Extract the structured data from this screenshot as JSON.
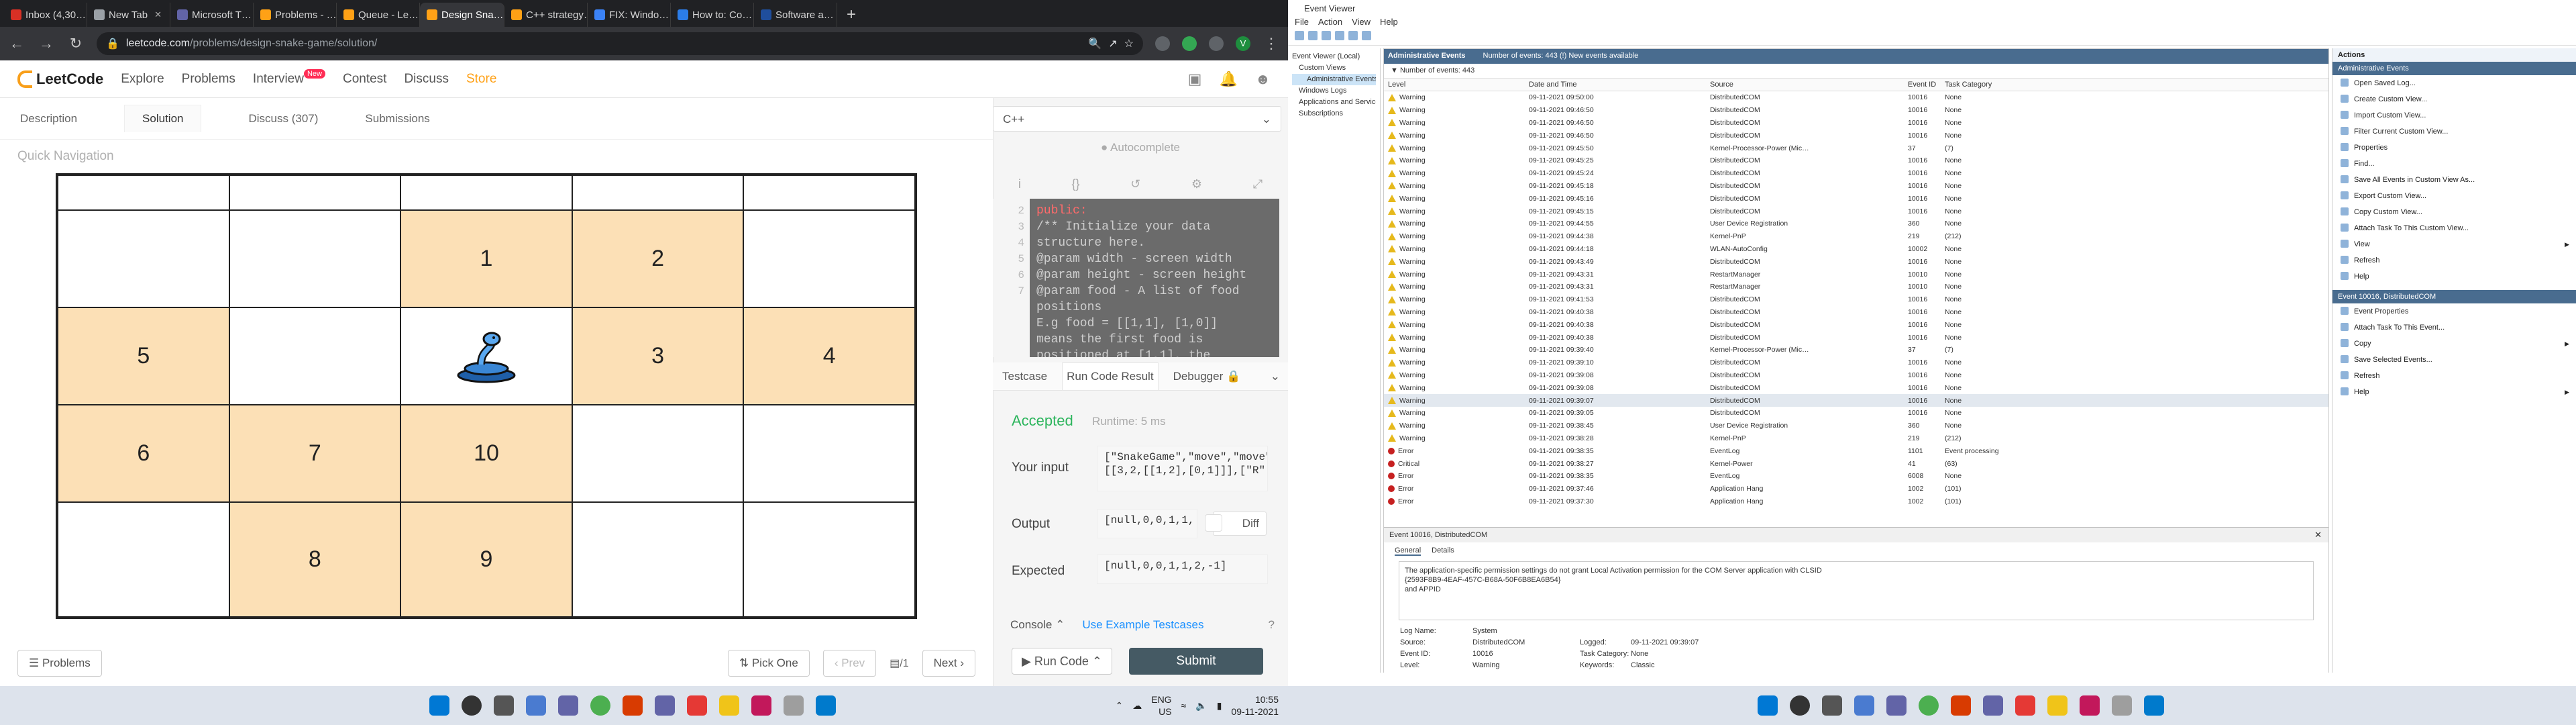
{
  "browser": {
    "tabs": [
      {
        "title": "Inbox (4,30…",
        "color": "#d93025"
      },
      {
        "title": "New Tab",
        "color": "#9aa0a6"
      },
      {
        "title": "Microsoft T…",
        "color": "#6264a7"
      },
      {
        "title": "Problems - …",
        "color": "#ffa116"
      },
      {
        "title": "Queue - Le…",
        "color": "#ffa116"
      },
      {
        "title": "Design Sna…",
        "color": "#ffa116"
      },
      {
        "title": "C++ strategy…",
        "color": "#ffa116"
      },
      {
        "title": "FIX: Windo…",
        "color": "#3b82f6"
      },
      {
        "title": "How to: Co…",
        "color": "#2b7de9"
      },
      {
        "title": "Software a…",
        "color": "#1f4e9c"
      }
    ],
    "url_domain": "leetcode.com",
    "url_path": "/problems/design-snake-game/solution/",
    "profile_initial": "V"
  },
  "leetcode": {
    "logo": "LeetCode",
    "nav": {
      "explore": "Explore",
      "problems": "Problems",
      "interview": "Interview",
      "new_badge": "New",
      "contest": "Contest",
      "discuss": "Discuss",
      "store": "Store"
    },
    "tabs": {
      "description": "Description",
      "solution": "Solution",
      "discuss": "Discuss (307)",
      "submissions": "Submissions"
    },
    "quick_nav": "Quick Navigation",
    "board": [
      [
        "",
        "",
        "",
        "",
        ""
      ],
      [
        "",
        "",
        "1",
        "2",
        ""
      ],
      [
        "5",
        "",
        "snake",
        "3",
        "4"
      ],
      [
        "6",
        "7",
        "10",
        "",
        ""
      ],
      [
        "",
        "8",
        "9",
        "",
        ""
      ]
    ],
    "board_fill": [
      [
        0,
        0,
        0,
        0,
        0
      ],
      [
        0,
        0,
        1,
        1,
        0
      ],
      [
        1,
        0,
        0,
        1,
        1
      ],
      [
        1,
        1,
        1,
        0,
        0
      ],
      [
        0,
        1,
        1,
        0,
        0
      ]
    ],
    "bottom": {
      "problems": "Problems",
      "pick_one": "Pick One",
      "prev": "Prev",
      "page": "1",
      "next": "Next"
    },
    "editor": {
      "language": "C++",
      "autocomplete": "Autocomplete",
      "line_numbers": [
        "2",
        "3",
        "4",
        "5",
        "6",
        "",
        "7"
      ],
      "code": [
        "public:",
        "/** Initialize your data",
        "structure here.",
        "@param width - screen width",
        "@param height - screen height",
        "@param food - A list of food",
        "positions",
        "E.g food = [[1,1], [1,0]]",
        "means the first food is",
        "positioned at [1,1], the"
      ]
    },
    "result": {
      "tab_testcase": "Testcase",
      "tab_run": "Run Code Result",
      "tab_debugger": "Debugger",
      "status": "Accepted",
      "runtime": "Runtime: 5 ms",
      "input_label": "Your input",
      "input_line1": "[\"SnakeGame\",\"move\",\"move\"",
      "input_line2": "[[3,2,[[1,2],[0,1]]],[\"R\"",
      "output_label": "Output",
      "output_value": "[null,0,0,1,1,",
      "diff": "Diff",
      "expected_label": "Expected",
      "expected_value": "[null,0,0,1,1,2,-1]"
    },
    "footer": {
      "console": "Console",
      "examples": "Use Example Testcases",
      "run": "Run Code",
      "submit": "Submit"
    }
  },
  "taskbar_left": {
    "lang1": "ENG",
    "lang2": "US",
    "time": "10:55",
    "date": "09-11-2021"
  },
  "event_viewer": {
    "title": "Event Viewer",
    "menu": [
      "File",
      "Action",
      "View",
      "Help"
    ],
    "tree": [
      "Event Viewer (Local)",
      "Custom Views",
      "Administrative Events",
      "Windows Logs",
      "Applications and Services Lo…",
      "Subscriptions"
    ],
    "header_title": "Administrative Events",
    "header_count": "Number of events: 443 (!) New events available",
    "filter": "Number of events: 443",
    "columns": [
      "Level",
      "Date and Time",
      "Source",
      "Event ID",
      "Task Category"
    ],
    "rows": [
      [
        "Warning",
        "09-11-2021 09:50:00",
        "DistributedCOM",
        "10016",
        "None"
      ],
      [
        "Warning",
        "09-11-2021 09:46:50",
        "DistributedCOM",
        "10016",
        "None"
      ],
      [
        "Warning",
        "09-11-2021 09:46:50",
        "DistributedCOM",
        "10016",
        "None"
      ],
      [
        "Warning",
        "09-11-2021 09:46:50",
        "DistributedCOM",
        "10016",
        "None"
      ],
      [
        "Warning",
        "09-11-2021 09:45:50",
        "Kernel-Processor-Power (Mic…",
        "37",
        "(7)"
      ],
      [
        "Warning",
        "09-11-2021 09:45:25",
        "DistributedCOM",
        "10016",
        "None"
      ],
      [
        "Warning",
        "09-11-2021 09:45:24",
        "DistributedCOM",
        "10016",
        "None"
      ],
      [
        "Warning",
        "09-11-2021 09:45:18",
        "DistributedCOM",
        "10016",
        "None"
      ],
      [
        "Warning",
        "09-11-2021 09:45:16",
        "DistributedCOM",
        "10016",
        "None"
      ],
      [
        "Warning",
        "09-11-2021 09:45:15",
        "DistributedCOM",
        "10016",
        "None"
      ],
      [
        "Warning",
        "09-11-2021 09:44:55",
        "User Device Registration",
        "360",
        "None"
      ],
      [
        "Warning",
        "09-11-2021 09:44:38",
        "Kernel-PnP",
        "219",
        "(212)"
      ],
      [
        "Warning",
        "09-11-2021 09:44:18",
        "WLAN-AutoConfig",
        "10002",
        "None"
      ],
      [
        "Warning",
        "09-11-2021 09:43:49",
        "DistributedCOM",
        "10016",
        "None"
      ],
      [
        "Warning",
        "09-11-2021 09:43:31",
        "RestartManager",
        "10010",
        "None"
      ],
      [
        "Warning",
        "09-11-2021 09:43:31",
        "RestartManager",
        "10010",
        "None"
      ],
      [
        "Warning",
        "09-11-2021 09:41:53",
        "DistributedCOM",
        "10016",
        "None"
      ],
      [
        "Warning",
        "09-11-2021 09:40:38",
        "DistributedCOM",
        "10016",
        "None"
      ],
      [
        "Warning",
        "09-11-2021 09:40:38",
        "DistributedCOM",
        "10016",
        "None"
      ],
      [
        "Warning",
        "09-11-2021 09:40:38",
        "DistributedCOM",
        "10016",
        "None"
      ],
      [
        "Warning",
        "09-11-2021 09:39:40",
        "Kernel-Processor-Power (Mic…",
        "37",
        "(7)"
      ],
      [
        "Warning",
        "09-11-2021 09:39:10",
        "DistributedCOM",
        "10016",
        "None"
      ],
      [
        "Warning",
        "09-11-2021 09:39:08",
        "DistributedCOM",
        "10016",
        "None"
      ],
      [
        "Warning",
        "09-11-2021 09:39:08",
        "DistributedCOM",
        "10016",
        "None"
      ],
      [
        "Warning",
        "09-11-2021 09:39:07",
        "DistributedCOM",
        "10016",
        "None"
      ],
      [
        "Warning",
        "09-11-2021 09:39:05",
        "DistributedCOM",
        "10016",
        "None"
      ],
      [
        "Warning",
        "09-11-2021 09:38:45",
        "User Device Registration",
        "360",
        "None"
      ],
      [
        "Warning",
        "09-11-2021 09:38:28",
        "Kernel-PnP",
        "219",
        "(212)"
      ],
      [
        "Error",
        "09-11-2021 09:38:35",
        "EventLog",
        "1101",
        "Event processing"
      ],
      [
        "Critical",
        "09-11-2021 09:38:27",
        "Kernel-Power",
        "41",
        "(63)"
      ],
      [
        "Error",
        "09-11-2021 09:38:35",
        "EventLog",
        "6008",
        "None"
      ],
      [
        "Error",
        "09-11-2021 09:37:46",
        "Application Hang",
        "1002",
        "(101)"
      ],
      [
        "Error",
        "09-11-2021 09:37:30",
        "Application Hang",
        "1002",
        "(101)"
      ]
    ],
    "selected_row": 24,
    "detail": {
      "title": "Event 10016, DistributedCOM",
      "tabs": [
        "General",
        "Details"
      ],
      "message1": "The application-specific permission settings do not grant Local Activation permission for the COM Server application with CLSID",
      "message2": "{2593F8B9-4EAF-457C-B68A-50F6B8EA6B54}",
      "message3": "and APPID",
      "fields": [
        [
          "Log Name:",
          "System",
          "",
          ""
        ],
        [
          "Source:",
          "DistributedCOM",
          "Logged:",
          "09-11-2021 09:39:07"
        ],
        [
          "Event ID:",
          "10016",
          "Task Category:",
          "None"
        ],
        [
          "Level:",
          "Warning",
          "Keywords:",
          "Classic"
        ]
      ]
    },
    "actions": {
      "header": "Actions",
      "sec1": "Administrative Events",
      "items1": [
        "Open Saved Log...",
        "Create Custom View...",
        "Import Custom View...",
        "Filter Current Custom View...",
        "Properties",
        "Find...",
        "Save All Events in Custom View As...",
        "Export Custom View...",
        "Copy Custom View...",
        "Attach Task To This Custom View...",
        "View",
        "Refresh",
        "Help"
      ],
      "sec2": "Event 10016, DistributedCOM",
      "items2": [
        "Event Properties",
        "Attach Task To This Event...",
        "Copy",
        "Save Selected Events...",
        "Refresh",
        "Help"
      ]
    }
  }
}
